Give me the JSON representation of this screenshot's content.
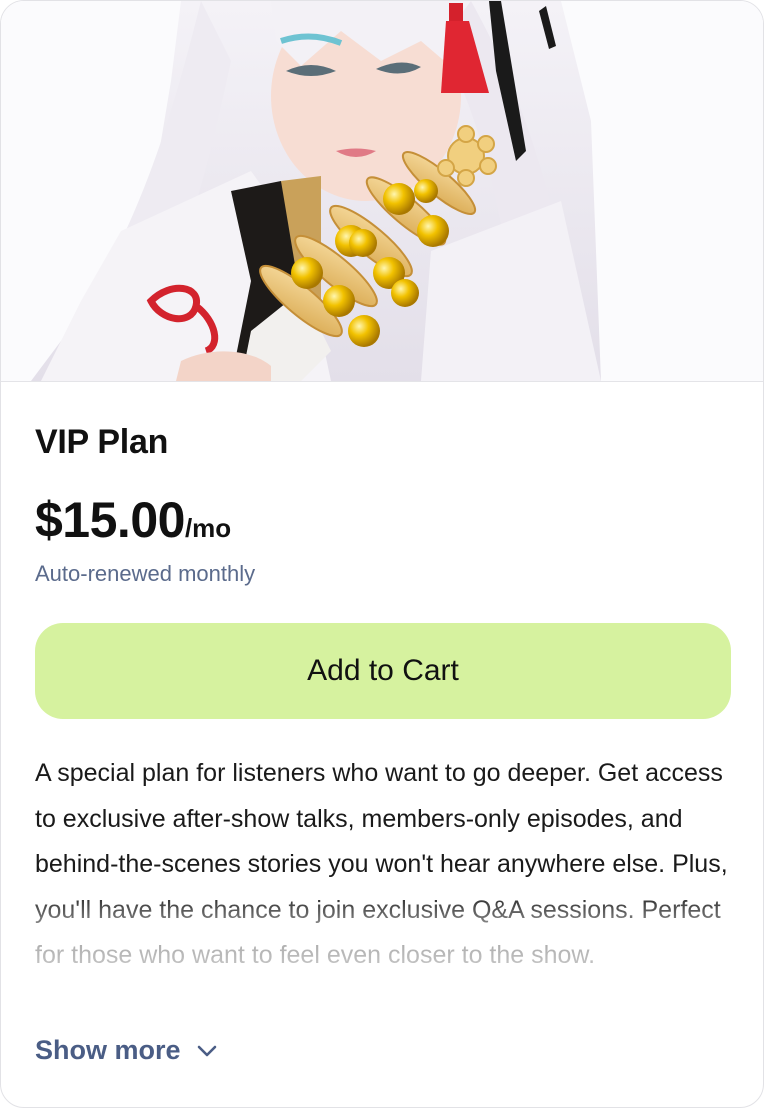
{
  "product": {
    "image_alt": "Cosplayer with white hair holding golden bell ornament",
    "title": "VIP Plan",
    "price": "$15.00",
    "period": "/mo",
    "renewal_note": "Auto-renewed monthly",
    "add_to_cart_label": "Add to Cart",
    "description": "A special plan for listeners who want to go deeper. Get access to exclusive after-show talks, members-only episodes, and behind-the-scenes stories you won't hear anywhere else. Plus, you'll have the chance to join exclusive Q&A sessions. Perfect for those who want to feel even closer to the show.",
    "show_more_label": "Show more",
    "show_more_icon": "chevron-down-icon"
  },
  "colors": {
    "button_bg": "#d6f29f",
    "muted_text": "#5b6b8c",
    "link_text": "#4a5d85"
  }
}
